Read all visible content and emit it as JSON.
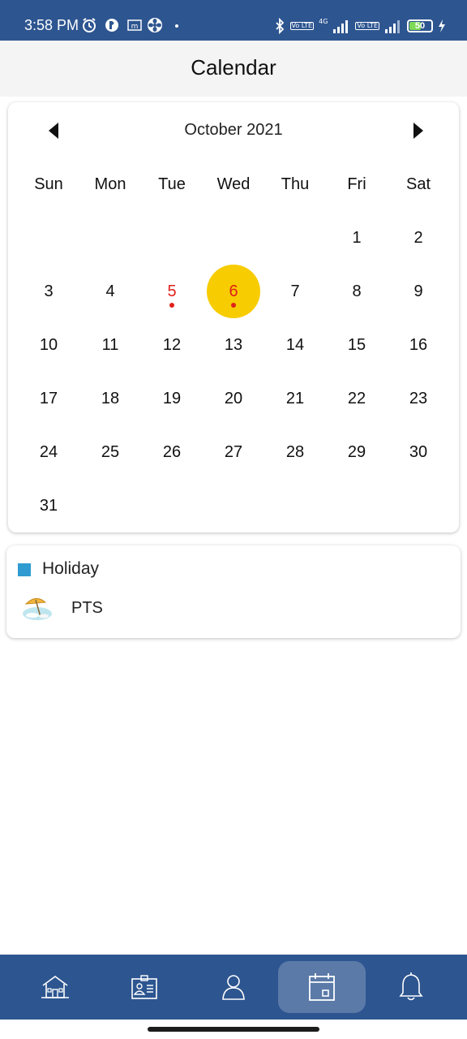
{
  "status_bar": {
    "time": "3:58 PM",
    "battery": "50",
    "network_1": "Vo LTE",
    "network_2": "4G",
    "network_3": "Vo LTE",
    "left_icons": [
      "alarm-icon",
      "app-icon",
      "m-notification-icon",
      "fan-icon",
      "dot-icon"
    ],
    "right_icons": [
      "bluetooth-icon",
      "signal-icon",
      "signal-icon",
      "battery-icon",
      "charging-icon"
    ]
  },
  "header": {
    "title": "Calendar"
  },
  "calendar": {
    "month_label": "October 2021",
    "prev_icon": "caret-left-icon",
    "next_icon": "caret-right-icon",
    "weekdays": [
      "Sun",
      "Mon",
      "Tue",
      "Wed",
      "Thu",
      "Fri",
      "Sat"
    ],
    "weeks": [
      [
        "",
        "",
        "",
        "",
        "",
        "1",
        "2"
      ],
      [
        "3",
        "4",
        "5",
        "6",
        "7",
        "8",
        "9"
      ],
      [
        "10",
        "11",
        "12",
        "13",
        "14",
        "15",
        "16"
      ],
      [
        "17",
        "18",
        "19",
        "20",
        "21",
        "22",
        "23"
      ],
      [
        "24",
        "25",
        "26",
        "27",
        "28",
        "29",
        "30"
      ],
      [
        "31",
        "",
        "",
        "",
        "",
        "",
        ""
      ]
    ],
    "holiday_days": [
      "5",
      "6"
    ],
    "selected_day": "6",
    "colors": {
      "holiday_text": "#e0201a",
      "selected_bg": "#f7cc00"
    }
  },
  "legend": {
    "category_label": "Holiday",
    "category_color": "#2f9bd1",
    "event_icon": "beach-umbrella-icon",
    "event_name": "PTS"
  },
  "bottom_nav": {
    "items": [
      {
        "icon": "home-icon",
        "active": false
      },
      {
        "icon": "id-card-icon",
        "active": false
      },
      {
        "icon": "user-icon",
        "active": false
      },
      {
        "icon": "calendar-icon",
        "active": true
      },
      {
        "icon": "bell-icon",
        "active": false
      }
    ],
    "colors": {
      "background": "#2d5590"
    }
  }
}
